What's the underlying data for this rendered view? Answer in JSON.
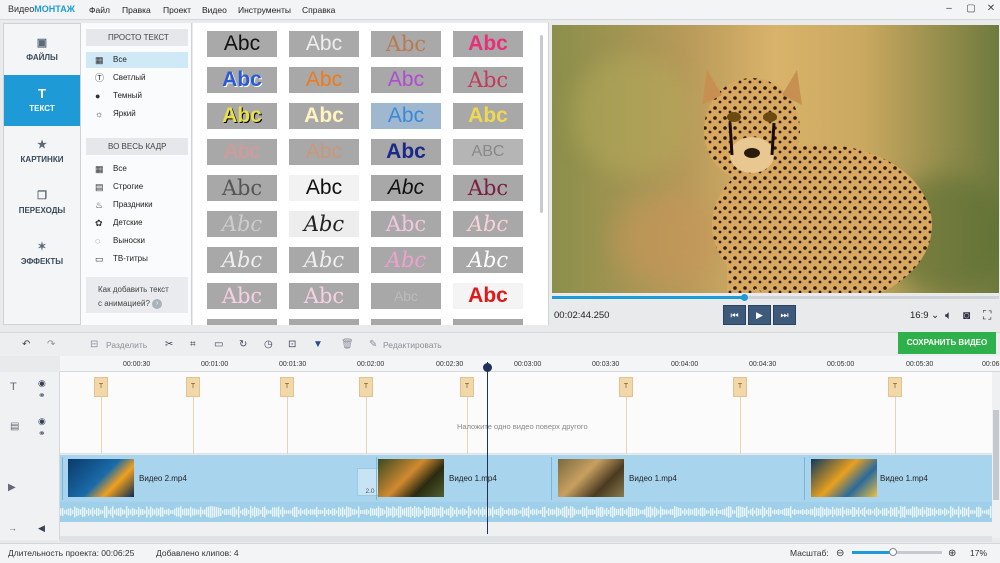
{
  "app": {
    "title_prefix": "Видео",
    "title_brand": "МОНТАЖ"
  },
  "menu": [
    "Файл",
    "Правка",
    "Проект",
    "Видео",
    "Инструменты",
    "Справка"
  ],
  "window_controls": [
    "–",
    "▢",
    "✕"
  ],
  "nav": [
    {
      "label": "ФАЙЛЫ",
      "icon": "image-icon"
    },
    {
      "label": "ТЕКСТ",
      "icon": "text-t-icon"
    },
    {
      "label": "КАРТИНКИ",
      "icon": "star-icon"
    },
    {
      "label": "ПЕРЕХОДЫ",
      "icon": "transitions-icon"
    },
    {
      "label": "ЭФФЕКТЫ",
      "icon": "magic-wand-icon"
    }
  ],
  "categories": {
    "simple_header": "ПРОСТО ТЕКСТ",
    "simple_items": [
      "Все",
      "Светлый",
      "Темный",
      "Яркий"
    ],
    "frame_header": "ВО ВЕСЬ КАДР",
    "frame_items": [
      "Все",
      "Строгие",
      "Праздники",
      "Детские",
      "Выноски",
      "ТВ-титры"
    ],
    "howto_line1": "Как добавить текст",
    "howto_line2": "с анимацией?"
  },
  "styles": {
    "sample_text": "Abc"
  },
  "player": {
    "timecode": "00:02:44.250",
    "aspect": "16:9",
    "progress": 0.43
  },
  "toolbar": {
    "split": "Разделить",
    "edit": "Редактировать",
    "save": "СОХРАНИТЬ ВИДЕО"
  },
  "ruler": [
    "00:00:30",
    "00:01:00",
    "00:01:30",
    "00:02:00",
    "00:02:30",
    "00:03:00",
    "00:03:30",
    "00:04:00",
    "00:04:30",
    "00:05:00",
    "00:05:30",
    "00:06"
  ],
  "timeline": {
    "overlay_hint": "Наложите одно видео поверх другого",
    "transition_duration": "2.0",
    "clips": [
      "Видео 2.mp4",
      "Видео 1.mp4",
      "Видео 1.mp4",
      "Видео 1.mp4"
    ]
  },
  "status": {
    "duration": "Длительность проекта: 00:06:25",
    "clips_added": "Добавлено клипов: 4",
    "zoom_label": "Масштаб:",
    "zoom_value": "17%",
    "zoom_level": 0.45
  },
  "colors": {
    "accent": "#1e9bd7",
    "save": "#2eb14a",
    "track": "#a8d4ee"
  }
}
